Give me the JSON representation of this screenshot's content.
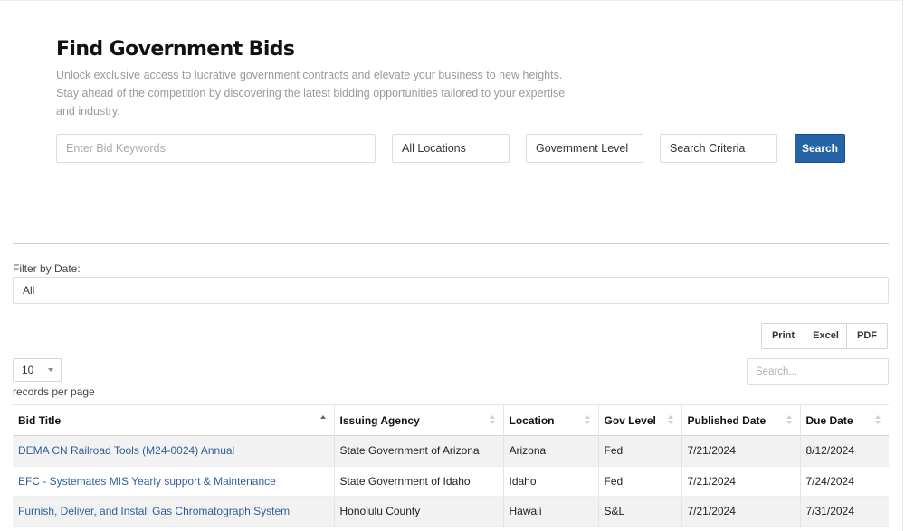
{
  "hero": {
    "title": "Find Government Bids",
    "description": "Unlock exclusive access to lucrative government contracts and elevate your business to new heights. Stay ahead of the competition by discovering the latest bidding opportunities tailored to your expertise and industry."
  },
  "search": {
    "keywords_placeholder": "Enter Bid Keywords",
    "location": "All Locations",
    "government_level": "Government Level",
    "criteria": "Search Criteria",
    "button_label": "Search",
    "button_color": "#2563a6"
  },
  "filter": {
    "label": "Filter by Date:",
    "value": "All"
  },
  "export_buttons": [
    "Print",
    "Excel",
    "PDF"
  ],
  "page_length": {
    "value": "10",
    "label": "records per page"
  },
  "table_search": {
    "placeholder": "Search..."
  },
  "table": {
    "columns": [
      "Bid Title",
      "Issuing Agency",
      "Location",
      "Gov Level",
      "Published Date",
      "Due Date"
    ],
    "sorted_column": "Bid Title",
    "sort_direction": "ascending",
    "rows": [
      [
        "DEMA CN Railroad Tools (M24-0024) Annual",
        "State Government of Arizona",
        "Arizona",
        "Fed",
        "7/21/2024",
        "8/12/2024"
      ],
      [
        "EFC - Systemates MIS Yearly support & Maintenance",
        "State Government of Idaho",
        "Idaho",
        "Fed",
        "7/21/2024",
        "7/24/2024"
      ],
      [
        "Furnish, Deliver, and Install Gas Chromatograph System",
        "Honolulu County",
        "Hawaii",
        "S&L",
        "7/21/2024",
        "7/31/2024"
      ]
    ]
  }
}
